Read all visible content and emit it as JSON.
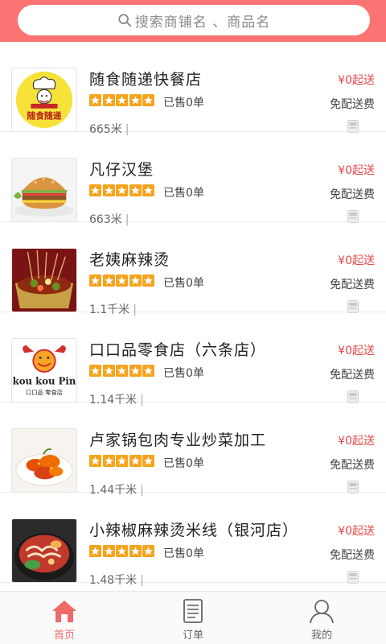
{
  "search": {
    "placeholder": "搜索商铺名 、商品名"
  },
  "shops": [
    {
      "name": "随食随递快餐店",
      "sold": "已售0单",
      "distance": "665米",
      "min_order": "¥0起送",
      "delivery": "免配送费",
      "rating": 5,
      "logo_text": "随食随递"
    },
    {
      "name": "凡仔汉堡",
      "sold": "已售0单",
      "distance": "663米",
      "min_order": "¥0起送",
      "delivery": "免配送费",
      "rating": 5
    },
    {
      "name": "老姨麻辣烫",
      "sold": "已售0单",
      "distance": "1.1千米",
      "min_order": "¥0起送",
      "delivery": "免配送费",
      "rating": 5
    },
    {
      "name": "口口品零食店（六条店）",
      "sold": "已售0单",
      "distance": "1.14千米",
      "min_order": "¥0起送",
      "delivery": "免配送费",
      "rating": 5,
      "logo_text": "kou kou Pin",
      "logo_subtext": "口口品 零食店"
    },
    {
      "name": "卢家锅包肉专业炒菜加工",
      "sold": "已售0单",
      "distance": "1.44千米",
      "min_order": "¥0起送",
      "delivery": "免配送费",
      "rating": 5
    },
    {
      "name": "小辣椒麻辣烫米线（银河店）",
      "sold": "已售0单",
      "distance": "1.48千米",
      "min_order": "¥0起送",
      "delivery": "免配送费",
      "rating": 5
    }
  ],
  "tabs": [
    {
      "label": "首页",
      "icon": "home-icon",
      "active": true
    },
    {
      "label": "订单",
      "icon": "order-list-icon",
      "active": false
    },
    {
      "label": "我的",
      "icon": "user-icon",
      "active": false
    }
  ],
  "colors": {
    "header": "#fb7373",
    "star": "#f5a41e",
    "price": "#e54848",
    "active_tab": "#f06a6a"
  }
}
